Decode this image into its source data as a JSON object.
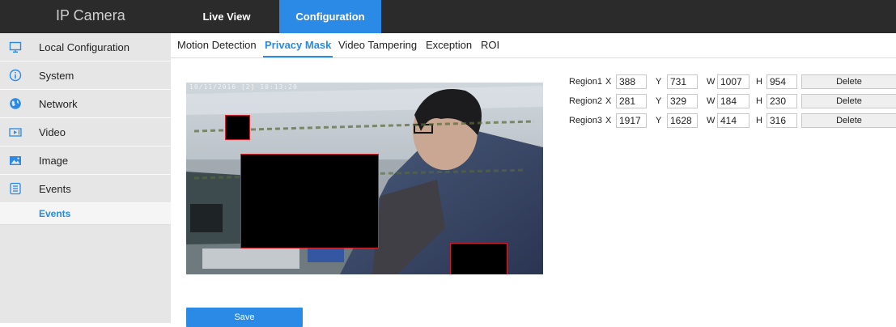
{
  "app": {
    "brand": "IP Camera"
  },
  "top_nav": {
    "live_view": "Live View",
    "configuration": "Configuration"
  },
  "sidebar": {
    "items": [
      {
        "label": "Local Configuration",
        "icon": "monitor-icon"
      },
      {
        "label": "System",
        "icon": "info-icon"
      },
      {
        "label": "Network",
        "icon": "globe-icon"
      },
      {
        "label": "Video",
        "icon": "video-icon"
      },
      {
        "label": "Image",
        "icon": "image-icon"
      },
      {
        "label": "Events",
        "icon": "events-icon"
      }
    ],
    "sub_item": "Events"
  },
  "tabs": [
    "Motion Detection",
    "Privacy Mask",
    "Video Tampering",
    "Exception",
    "ROI"
  ],
  "active_tab": "Privacy Mask",
  "video": {
    "osd_text": "10/11/2016 [2] 10:13:20"
  },
  "regions": [
    {
      "label": "Region1",
      "x_label": "X",
      "x": "388",
      "y_label": "Y",
      "y": "731",
      "w_label": "W",
      "w": "1007",
      "h_label": "H",
      "h": "954",
      "delete_label": "Delete"
    },
    {
      "label": "Region2",
      "x_label": "X",
      "x": "281",
      "y_label": "Y",
      "y": "329",
      "w_label": "W",
      "w": "184",
      "h_label": "H",
      "h": "230",
      "delete_label": "Delete"
    },
    {
      "label": "Region3",
      "x_label": "X",
      "x": "1917",
      "y_label": "Y",
      "y": "1628",
      "w_label": "W",
      "w": "414",
      "h_label": "H",
      "h": "316",
      "delete_label": "Delete"
    }
  ],
  "save_label": "Save",
  "colors": {
    "accent": "#2a8ae6",
    "topbar": "#2b2b2b",
    "sidebar": "#e6e6e6",
    "mask_border": "#d0202a"
  }
}
